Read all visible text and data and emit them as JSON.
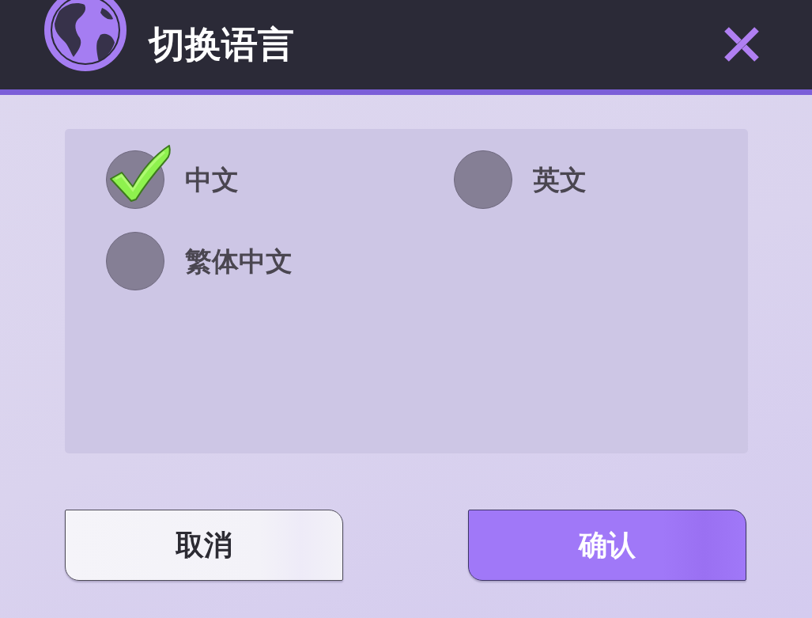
{
  "header": {
    "title": "切换语言"
  },
  "options": [
    {
      "label": "中文",
      "selected": true
    },
    {
      "label": "英文",
      "selected": false
    },
    {
      "label": "繁体中文",
      "selected": false
    }
  ],
  "buttons": [
    {
      "label": "取消",
      "kind": "secondary"
    },
    {
      "label": "确认",
      "kind": "primary"
    }
  ]
}
